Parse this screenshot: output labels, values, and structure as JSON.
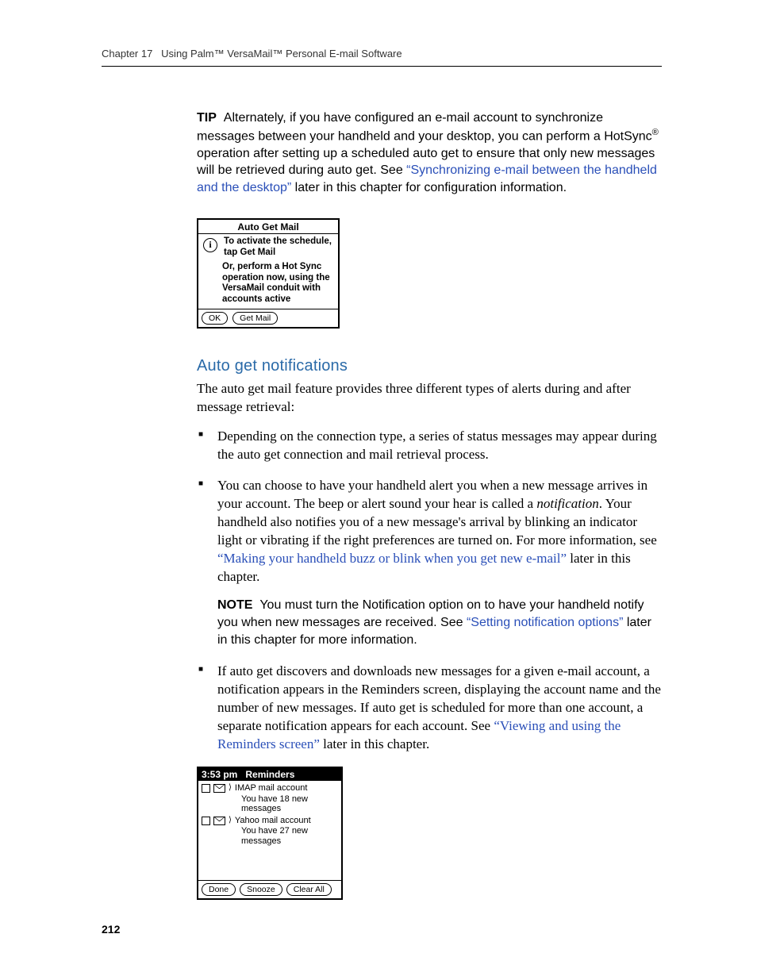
{
  "runningHead": {
    "chapter": "Chapter 17",
    "title": "Using Palm™ VersaMail™ Personal E-mail Software"
  },
  "tip": {
    "label": "TIP",
    "pre": "Alternately, if you have configured an e-mail account to synchronize messages between your handheld and your desktop, you can perform a HotSync",
    "reg": "®",
    "mid": " operation after setting up a scheduled auto get to ensure that only new messages will be retrieved during auto get. See ",
    "link": "“Synchronizing e-mail between the handheld and the desktop”",
    "post": " later in this chapter for configuration information."
  },
  "fig1": {
    "title": "Auto Get Mail",
    "info_glyph": "i",
    "line1": "To activate the schedule, tap Get Mail",
    "line2": "Or, perform a Hot Sync operation now, using the VersaMail conduit with accounts active",
    "btn_ok": "OK",
    "btn_getmail": "Get Mail"
  },
  "h3": "Auto get notifications",
  "intro": "The auto get mail feature provides three different types of alerts during and after message retrieval:",
  "bullets": {
    "b1": "Depending on the connection type, a series of status messages may appear during the auto get connection and mail retrieval process.",
    "b2": {
      "pre": "You can choose to have your handheld alert you when a new message arrives in your account. The beep or alert sound your hear is called a ",
      "em": "notification",
      "mid": ". Your handheld also notifies you of a new message's arrival by blinking an indicator light or vibrating if the right preferences are turned on. For more information, see ",
      "link": "“Making your handheld buzz or blink when you get new e-mail”",
      "post": " later in this chapter."
    },
    "note": {
      "label": "NOTE",
      "pre": "You must turn the Notification option on to have your handheld notify you when new messages are received. See ",
      "link": "“Setting notification options”",
      "post": " later in this chapter for more information."
    },
    "b3": {
      "pre": "If auto get discovers and downloads new messages for a given e-mail account, a notification appears in the Reminders screen, displaying the account name and the number of new messages. If auto get is scheduled for more than one account, a separate notification appears for each account. See ",
      "link": "“Viewing and using the Reminders screen”",
      "post": " later in this chapter."
    }
  },
  "fig2": {
    "time": "3:53 pm",
    "title": "Reminders",
    "items": [
      {
        "acct": "IMAP mail account",
        "msg": "You have 18 new messages"
      },
      {
        "acct": "Yahoo mail account",
        "msg": "You have 27 new messages"
      }
    ],
    "btn_done": "Done",
    "btn_snooze": "Snooze",
    "btn_clear": "Clear All"
  },
  "pageNumber": "212"
}
